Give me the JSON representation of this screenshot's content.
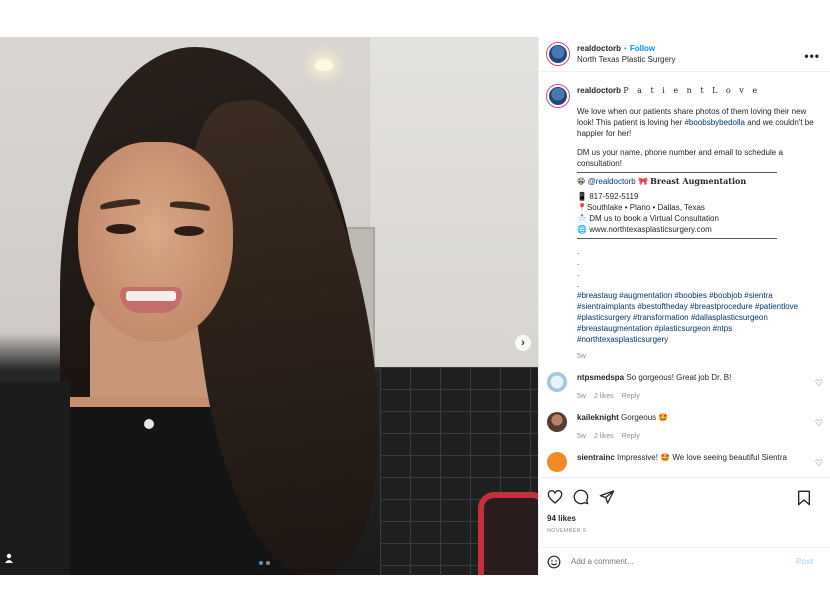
{
  "header": {
    "username": "realdoctorb",
    "separator": "•",
    "follow_label": "Follow",
    "location": "North Texas Plastic Surgery",
    "more_icon": "more-horizontal-icon"
  },
  "caption": {
    "username": "realdoctorb",
    "title": "P a t i e n t   L o v e",
    "p1_a": "We love when our patients share photos of them loving their new look! This patient is loving her ",
    "p1_tag": "#boobsbybedolla",
    "p1_b": " and we couldn't be happier for her!",
    "p2": "DM us your name, phone number and email to schedule a consultation!",
    "emoji1": "😁",
    "mention": "@realdoctorb",
    "emoji2": "🎀",
    "service": "Breast Augmentation",
    "phone_emoji": "📱",
    "phone": "817-592-5119",
    "pin_emoji": "📍",
    "locations": "Southlake • Plano • Dallas, Texas",
    "dm_emoji": "📩",
    "dm": "DM us to book a Virtual Consultation",
    "web_emoji": "🌐",
    "website": "www.northtexasplasticsurgery.com",
    "dot": ".",
    "hashtags": "#breastaug #augmentation #boobies #boobjob #sientra #sientraimplants #bestoftheday #breastprocedure #patientlove #plasticsurgery #transformation #dallasplasticsurgeon #breastaugmentation #plasticsurgeon #ntps #northtexasplasticsurgery",
    "time": "5w"
  },
  "comments": [
    {
      "username": "ntpsmedspa",
      "text": "So gorgeous! Great job Dr. B!",
      "time": "5w",
      "likes": "2 likes",
      "reply": "Reply"
    },
    {
      "username": "kaileknight",
      "text": "Gorgeous 🤩",
      "time": "5w",
      "likes": "2 likes",
      "reply": "Reply"
    },
    {
      "username": "sientrainc",
      "text": "Impressive! 🤩 We love seeing beautiful Sientra",
      "time": "",
      "likes": "",
      "reply": ""
    }
  ],
  "actions": {
    "likes": "94 likes",
    "date": "NOVEMBER 9"
  },
  "add_comment": {
    "emoji_icon": "smiley-icon",
    "placeholder": "Add a comment...",
    "post_label": "Post"
  },
  "media": {
    "next_icon": "›",
    "user_tag_icon": "person-icon"
  },
  "colors": {
    "link": "#0095f6",
    "hashtag": "#00376b",
    "muted": "#8e8e8e"
  }
}
